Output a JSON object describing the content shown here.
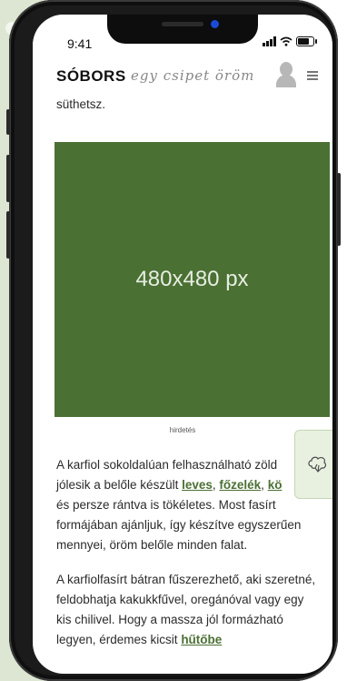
{
  "status_bar": {
    "time": "9:41"
  },
  "header": {
    "logo": "SÓBORS",
    "slogan": "egy csipet öröm"
  },
  "article": {
    "lead_text": "süthetsz.",
    "ad_box_text": "480x480 px",
    "ad_label": "hirdetés",
    "p1": {
      "t1": "A karfiol sokoldalúan felhasználható zöld",
      "t2": "jólesik a belőle készült ",
      "link_leves": "leves",
      "sep1": ", ",
      "link_fozelek": "főzelék",
      "sep2": ", ",
      "link_ko": "kö",
      "t3": "és persze rántva is tökéletes. Most fasírt formájában ajánljuk, így készítve egyszerűen mennyei, öröm belőle minden falat."
    },
    "p2": {
      "t1": "A karfiolfasírt bátran fűszerezhető, aki szeretné, feldobhatja kakukkfűvel, oregánóval vagy egy kis chilivel. Hogy a massza jól formázható legyen, érdemes kicsit ",
      "link_hutobe": "hűtőbe"
    }
  },
  "floating_button": {
    "icon": "cauliflower-icon"
  },
  "colors": {
    "accent_green": "#4a7033",
    "ad_background": "#4a7033"
  }
}
